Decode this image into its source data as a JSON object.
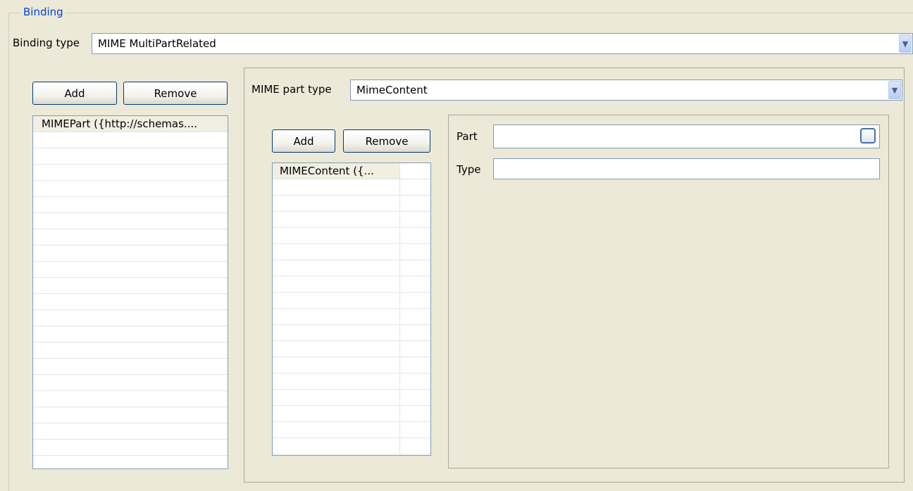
{
  "binding_group": {
    "legend": "Binding",
    "binding_type_label": "Binding type",
    "binding_type_value": "MIME MultiPartRelated"
  },
  "parts_panel": {
    "add_label": "Add",
    "remove_label": "Remove",
    "items": [
      "MIMEPart ({http://schemas...."
    ]
  },
  "mime_part_panel": {
    "part_type_label": "MIME part type",
    "part_type_value": "MimeContent",
    "add_label": "Add",
    "remove_label": "Remove",
    "contents": [
      "MIMEContent ({..."
    ],
    "part_label": "Part",
    "part_value": "",
    "type_label": "Type",
    "type_value": ""
  },
  "icons": {
    "dropdown": "chevron-down-icon",
    "browse": "browse-button"
  }
}
